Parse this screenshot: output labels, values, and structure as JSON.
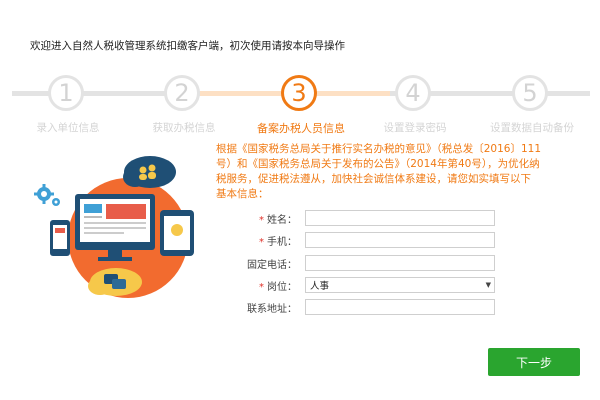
{
  "header": {
    "title": "欢迎进入自然人税收管理系统扣缴客户端，初次使用请按本向导操作"
  },
  "steps": [
    {
      "number": "1",
      "label": "录入单位信息",
      "state": "done"
    },
    {
      "number": "2",
      "label": "获取办税信息",
      "state": "done"
    },
    {
      "number": "3",
      "label": "备案办税人员信息",
      "state": "active"
    },
    {
      "number": "4",
      "label": "设置登录密码",
      "state": "todo"
    },
    {
      "number": "5",
      "label": "设置数据自动备份",
      "state": "todo"
    }
  ],
  "colors": {
    "accent": "#f07a14",
    "button": "#2aa52f",
    "inactive": "#e3e3e3"
  },
  "notice": "根据《国家税务总局关于推行实名办税的意见》（税总发〔2016〕111号）和《国家税务总局关于发布的公告》（2014年第40号），为优化纳税服务，促进税法遵从，加快社会诚信体系建设，请您如实填写以下基本信息：",
  "form": {
    "name_label": "姓名：",
    "phone_label": "手机：",
    "landline_label": "固定电话：",
    "position_label": "岗位：",
    "position_value": "人事",
    "address_label": "联系地址：",
    "required_mark": "*"
  },
  "next_button": "下一步",
  "icons": [
    "gear-icon",
    "people-icon",
    "chat-icon",
    "desktop-icon",
    "tablet-icon",
    "phone-icon"
  ]
}
